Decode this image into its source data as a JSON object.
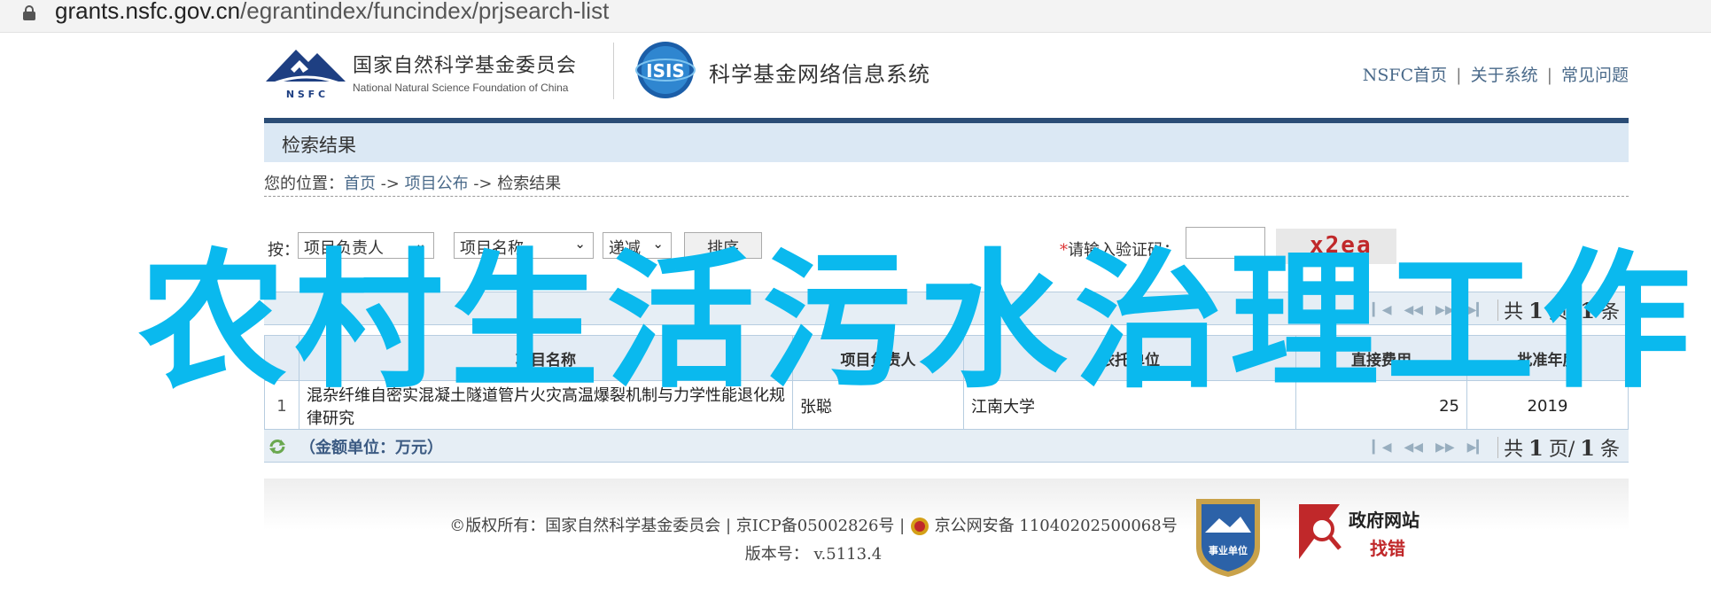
{
  "browser": {
    "url_host": "grants.nsfc.gov.cn",
    "url_path": "/egrantindex/funcindex/prjsearch-list"
  },
  "header": {
    "nsfc_cn": "国家自然科学基金委员会",
    "nsfc_en": "National Natural Science Foundation of China",
    "nsfc_abbr": "N S F C",
    "isis_abbr": "ISIS",
    "system_name": "科学基金网络信息系统",
    "nav": [
      "NSFC首页",
      "关于系统",
      "常见问题"
    ]
  },
  "page": {
    "section_title": "检索结果"
  },
  "breadcrumb": {
    "prefix": "您的位置：",
    "items": [
      "首页",
      "项目公布",
      "检索结果"
    ],
    "separator": " -> "
  },
  "filters": {
    "label": "按：",
    "sort_field_1": "项目负责人",
    "sort_field_2": "项目名称",
    "order": "递减",
    "sort_button": "排序",
    "captcha_label": "请输入验证码：",
    "captcha_text": "x2ea"
  },
  "pager": {
    "total_prefix": "共",
    "total_pages": "1",
    "total_suffix": "页/",
    "total_items": "1",
    "items_suffix": "条"
  },
  "table": {
    "headers": [
      "",
      "项目名称",
      "项目负责人",
      "依托单位",
      "直接费用",
      "批准年度"
    ],
    "rows": [
      {
        "idx": "1",
        "name": "混杂纤维自密实混凝土隧道管片火灾高温爆裂机制与力学性能退化规律研究",
        "leader": "张聪",
        "org": "江南大学",
        "cost": "25",
        "year": "2019"
      }
    ]
  },
  "units": "（金额单位：万元）",
  "footer": {
    "copyright": "©版权所有：国家自然科学基金委员会 | 京ICP备05002826号 |",
    "police": "京公网安备 11040202500068号",
    "version_label": "版本号：",
    "version": "v.5113.4",
    "badge_text": "事业单位",
    "gov_site_1": "政府网站",
    "gov_site_2": "找错"
  },
  "overlay": {
    "text": "农村生活污水治理工作"
  },
  "colors": {
    "overlay": "#0ab9ee",
    "nav_blue": "#2b4d76",
    "title_bar": "#dbe8f4",
    "captcha": "#c0282a"
  }
}
